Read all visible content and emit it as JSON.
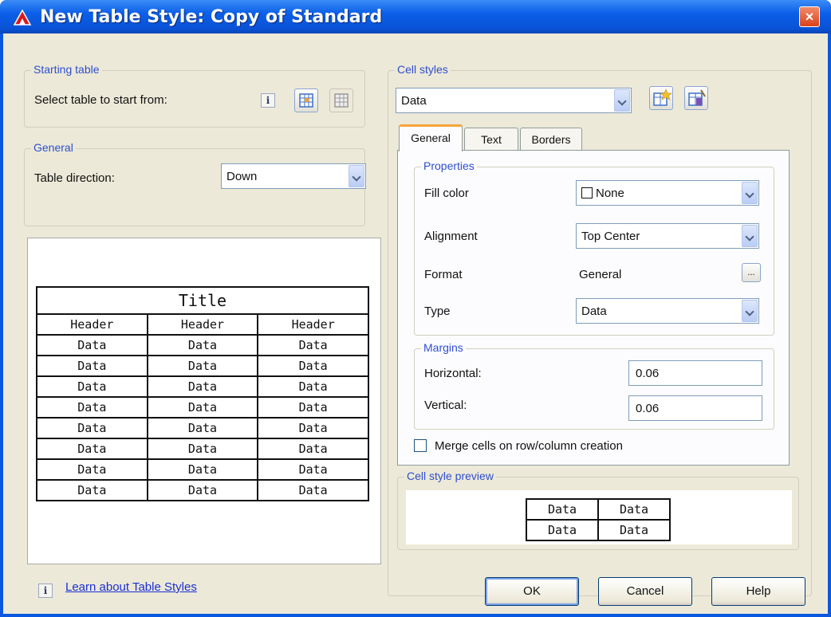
{
  "window": {
    "title": "New Table Style: Copy of Standard",
    "close": "×"
  },
  "starting_table": {
    "group_title": "Starting table",
    "select_label": "Select table to start from:",
    "info_glyph": "i"
  },
  "general": {
    "group_title": "General",
    "direction_label": "Table direction:",
    "direction_value": "Down"
  },
  "table_preview": {
    "title": "Title",
    "headers": [
      "Header",
      "Header",
      "Header"
    ],
    "rows": [
      [
        "Data",
        "Data",
        "Data"
      ],
      [
        "Data",
        "Data",
        "Data"
      ],
      [
        "Data",
        "Data",
        "Data"
      ],
      [
        "Data",
        "Data",
        "Data"
      ],
      [
        "Data",
        "Data",
        "Data"
      ],
      [
        "Data",
        "Data",
        "Data"
      ],
      [
        "Data",
        "Data",
        "Data"
      ],
      [
        "Data",
        "Data",
        "Data"
      ]
    ]
  },
  "cell_styles": {
    "group_title": "Cell styles",
    "selected": "Data",
    "tabs": [
      "General",
      "Text",
      "Borders"
    ],
    "active_tab": "General",
    "properties": {
      "group_title": "Properties",
      "fill_color_label": "Fill color",
      "fill_color_value": "None",
      "alignment_label": "Alignment",
      "alignment_value": "Top Center",
      "format_label": "Format",
      "format_value": "General",
      "format_button": "...",
      "type_label": "Type",
      "type_value": "Data"
    },
    "margins": {
      "group_title": "Margins",
      "horizontal_label": "Horizontal:",
      "horizontal_value": "0.06",
      "vertical_label": "Vertical:",
      "vertical_value": "0.06"
    },
    "merge_label": "Merge cells on row/column creation",
    "merge_checked": false
  },
  "cell_style_preview": {
    "group_title": "Cell style preview",
    "cells": [
      [
        "Data",
        "Data"
      ],
      [
        "Data",
        "Data"
      ]
    ]
  },
  "footer": {
    "info_glyph": "i",
    "link_text": "Learn about Table Styles",
    "ok": "OK",
    "cancel": "Cancel",
    "help": "Help"
  },
  "colors": {
    "titlebar": "#0b5fe8",
    "dialog_bg": "#ece9d8",
    "group_title": "#2e4fd0",
    "tab_highlight": "#f5a53a"
  }
}
